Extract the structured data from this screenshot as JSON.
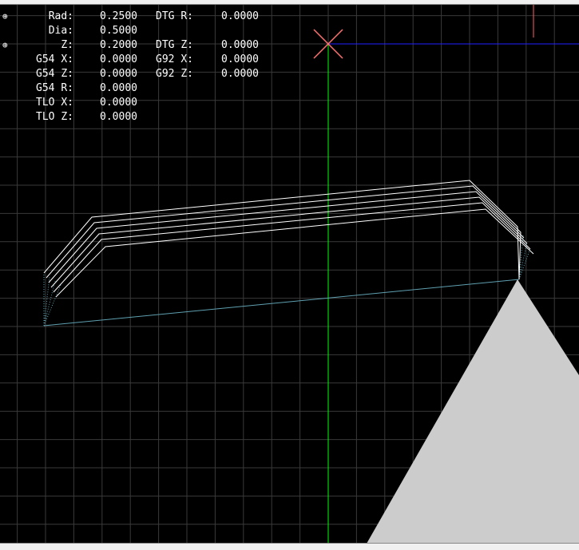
{
  "dro": {
    "left_column": [
      {
        "label": "Rad:",
        "value": "0.2500"
      },
      {
        "label": "Dia:",
        "value": "0.5000"
      },
      {
        "label": "Z:",
        "value": "0.2000"
      },
      {
        "label": "G54 X:",
        "value": "0.0000"
      },
      {
        "label": "G54 Z:",
        "value": "0.0000"
      },
      {
        "label": "G54 R:",
        "value": "0.0000"
      },
      {
        "label": "TLO X:",
        "value": "0.0000"
      },
      {
        "label": "TLO Z:",
        "value": "0.0000"
      }
    ],
    "right_column": [
      {
        "label": "DTG R:",
        "value": "0.0000"
      },
      {
        "label": "DTG Z:",
        "value": "0.0000"
      },
      {
        "label": "G92 X:",
        "value": "0.0000"
      },
      {
        "label": "G92 Z:",
        "value": "0.0000"
      }
    ],
    "homed_icon": "crosshair-circle-icon"
  },
  "colors": {
    "background": "#000000",
    "grid": "#3a3a3a",
    "x_axis": "#0000ff",
    "z_axis": "#00ff00",
    "origin_marker": "#ff6060",
    "toolpath": "#ffffff",
    "rapid_path": "#5fa0b0",
    "tool": "#cccccc"
  }
}
